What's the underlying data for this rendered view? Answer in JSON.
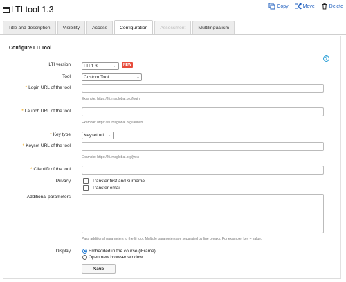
{
  "header": {
    "title": "LTI tool 1.3",
    "actions": {
      "copy": "Copy",
      "move": "Move",
      "delete": "Delete"
    }
  },
  "tabs": [
    {
      "label": "Title and description"
    },
    {
      "label": "Visibility"
    },
    {
      "label": "Access"
    },
    {
      "label": "Configuration"
    },
    {
      "label": "Assessment"
    },
    {
      "label": "Multilingualism"
    }
  ],
  "form": {
    "section_title": "Configure LTI Tool",
    "lti_version": {
      "label": "LTI version",
      "value": "LTI 1.3",
      "badge": "NEW"
    },
    "tool": {
      "label": "Tool",
      "value": "Custom Tool"
    },
    "login_url": {
      "label": "Login URL of the tool",
      "value": "",
      "example": "Example: https://lti.imsglobal.org/login"
    },
    "launch_url": {
      "label": "Launch URL of the tool",
      "value": "",
      "example": "Example: https://lti.imsglobal.org/launch"
    },
    "key_type": {
      "label": "Key type",
      "value": "Keyset url"
    },
    "keyset_url": {
      "label": "Keyset URL of the tool",
      "value": "",
      "example": "Example: https://lti.imsglobal.org/jwks"
    },
    "client_id": {
      "label": "ClientID of the tool",
      "value": ""
    },
    "privacy": {
      "label": "Privacy",
      "options": [
        {
          "label": "Transfer first and surname",
          "checked": false
        },
        {
          "label": "Transfer email",
          "checked": false
        }
      ]
    },
    "additional_parameters": {
      "label": "Additional parameters",
      "value": "",
      "help": "Pass additional parameters to the lti tool. Multiple parameters are separated by line breaks. For example: key = value."
    },
    "display": {
      "label": "Display",
      "options": [
        {
          "label": "Embedded in the course (iFrame)",
          "selected": true
        },
        {
          "label": "Open new browser window",
          "selected": false
        }
      ]
    },
    "save_label": "Save"
  },
  "colors": {
    "accent": "#2a7fd4",
    "link": "#1f5fbf",
    "required": "#f0a000",
    "badge": "#e74c3c"
  }
}
